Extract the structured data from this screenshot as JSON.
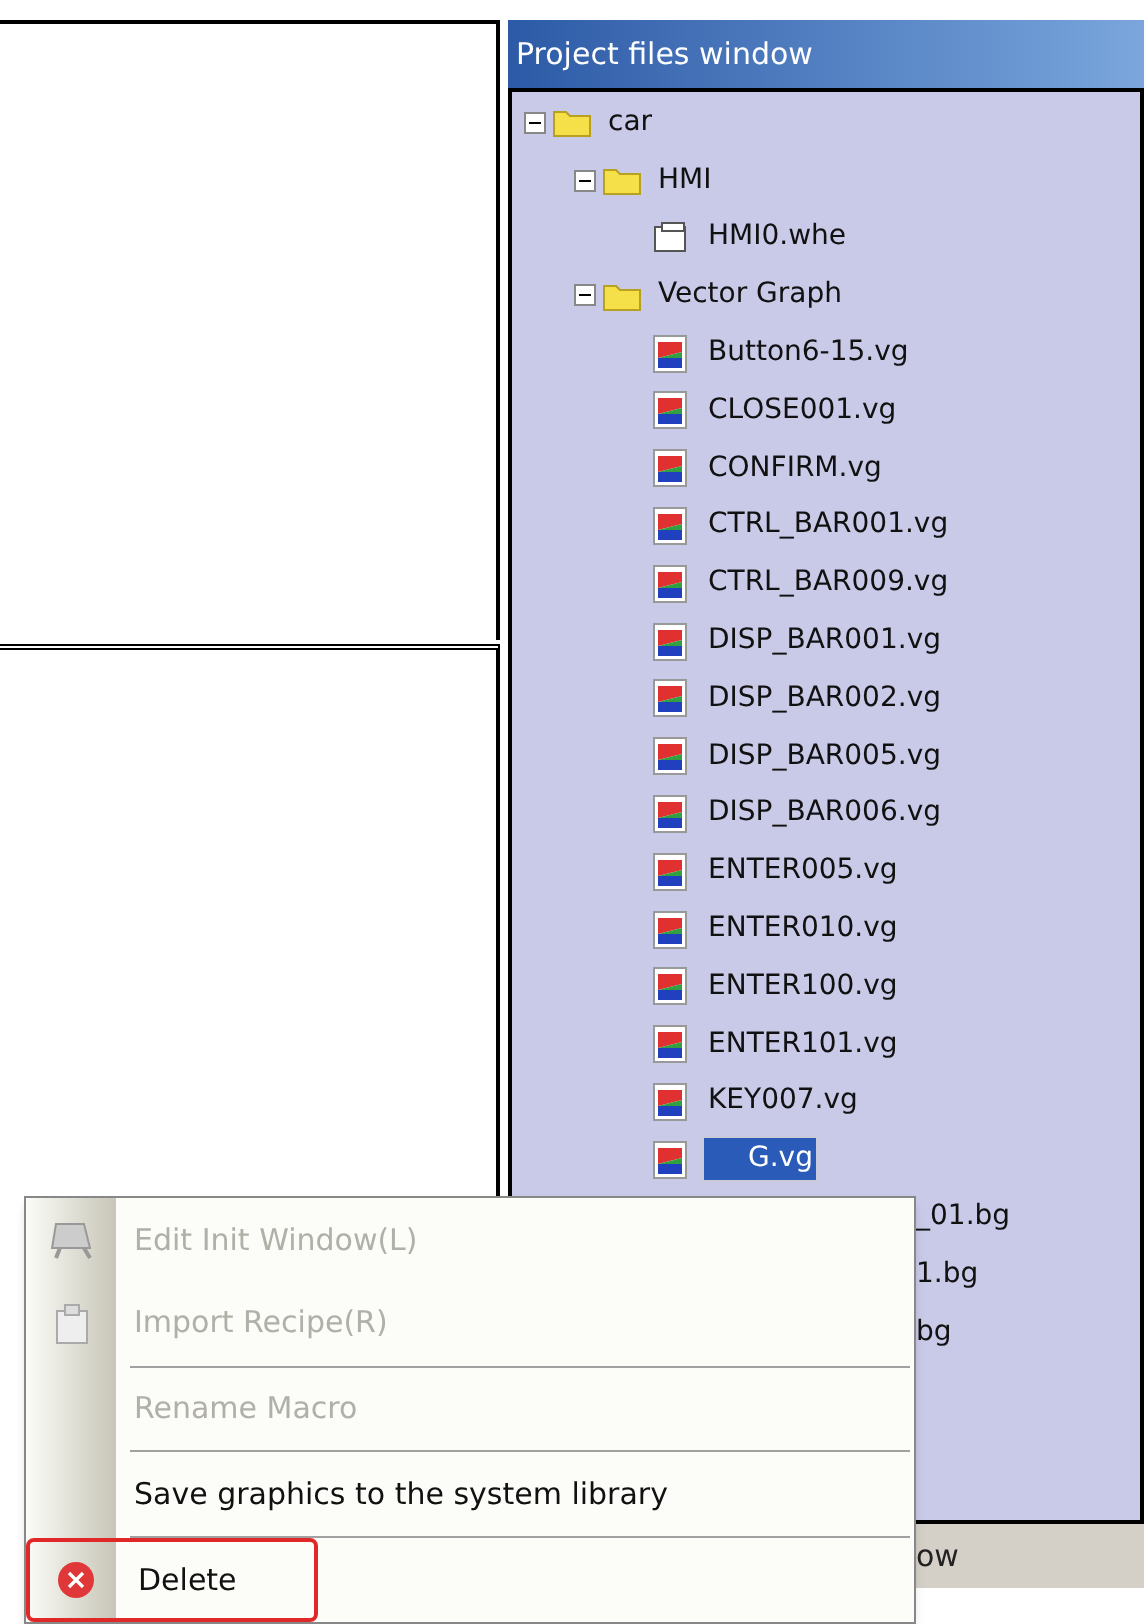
{
  "project_panel": {
    "title": "Project files window",
    "tree": [
      {
        "label": "car",
        "kind": "folder",
        "expanded": true,
        "selected": false,
        "children": [
          {
            "label": "HMI",
            "kind": "folder",
            "expanded": true,
            "selected": false,
            "children": [
              {
                "label": "HMI0.whe",
                "kind": "screen",
                "selected": false
              }
            ]
          },
          {
            "label": "Vector Graph",
            "kind": "folder",
            "expanded": true,
            "selected": false,
            "children": [
              {
                "label": "Button6-15.vg",
                "kind": "graphic",
                "selected": false
              },
              {
                "label": "CLOSE001.vg",
                "kind": "graphic",
                "selected": false
              },
              {
                "label": "CONFIRM.vg",
                "kind": "graphic",
                "selected": false
              },
              {
                "label": "CTRL_BAR001.vg",
                "kind": "graphic",
                "selected": false
              },
              {
                "label": "CTRL_BAR009.vg",
                "kind": "graphic",
                "selected": false
              },
              {
                "label": "DISP_BAR001.vg",
                "kind": "graphic",
                "selected": false
              },
              {
                "label": "DISP_BAR002.vg",
                "kind": "graphic",
                "selected": false
              },
              {
                "label": "DISP_BAR005.vg",
                "kind": "graphic",
                "selected": false
              },
              {
                "label": "DISP_BAR006.vg",
                "kind": "graphic",
                "selected": false
              },
              {
                "label": "ENTER005.vg",
                "kind": "graphic",
                "selected": false
              },
              {
                "label": "ENTER010.vg",
                "kind": "graphic",
                "selected": false
              },
              {
                "label": "ENTER100.vg",
                "kind": "graphic",
                "selected": false
              },
              {
                "label": "ENTER101.vg",
                "kind": "graphic",
                "selected": false
              },
              {
                "label": "KEY007.vg",
                "kind": "graphic",
                "selected": false
              },
              {
                "label": "G.vg",
                "kind": "graphic",
                "selected": true
              },
              {
                "label": "_01.bg",
                "kind": "covered",
                "selected": false
              },
              {
                "label": "1.bg",
                "kind": "covered",
                "selected": false
              },
              {
                "label": "bg",
                "kind": "covered",
                "selected": false
              }
            ]
          }
        ]
      }
    ],
    "bottom_tab": "ow"
  },
  "context_menu": [
    {
      "label": "Edit Init Window(L)",
      "kind": "window",
      "disabled": true,
      "separator_before": false,
      "highlighted": false
    },
    {
      "label": "Import Recipe(R)",
      "kind": "recipe",
      "disabled": true,
      "separator_before": false,
      "highlighted": false
    },
    {
      "label": "Rename Macro",
      "kind": "plain",
      "disabled": true,
      "separator_before": true,
      "highlighted": false
    },
    {
      "label": "Save graphics to the system library",
      "kind": "plain",
      "disabled": false,
      "separator_before": true,
      "highlighted": false
    },
    {
      "label": "Delete",
      "kind": "delete",
      "disabled": false,
      "separator_before": true,
      "highlighted": true
    }
  ]
}
